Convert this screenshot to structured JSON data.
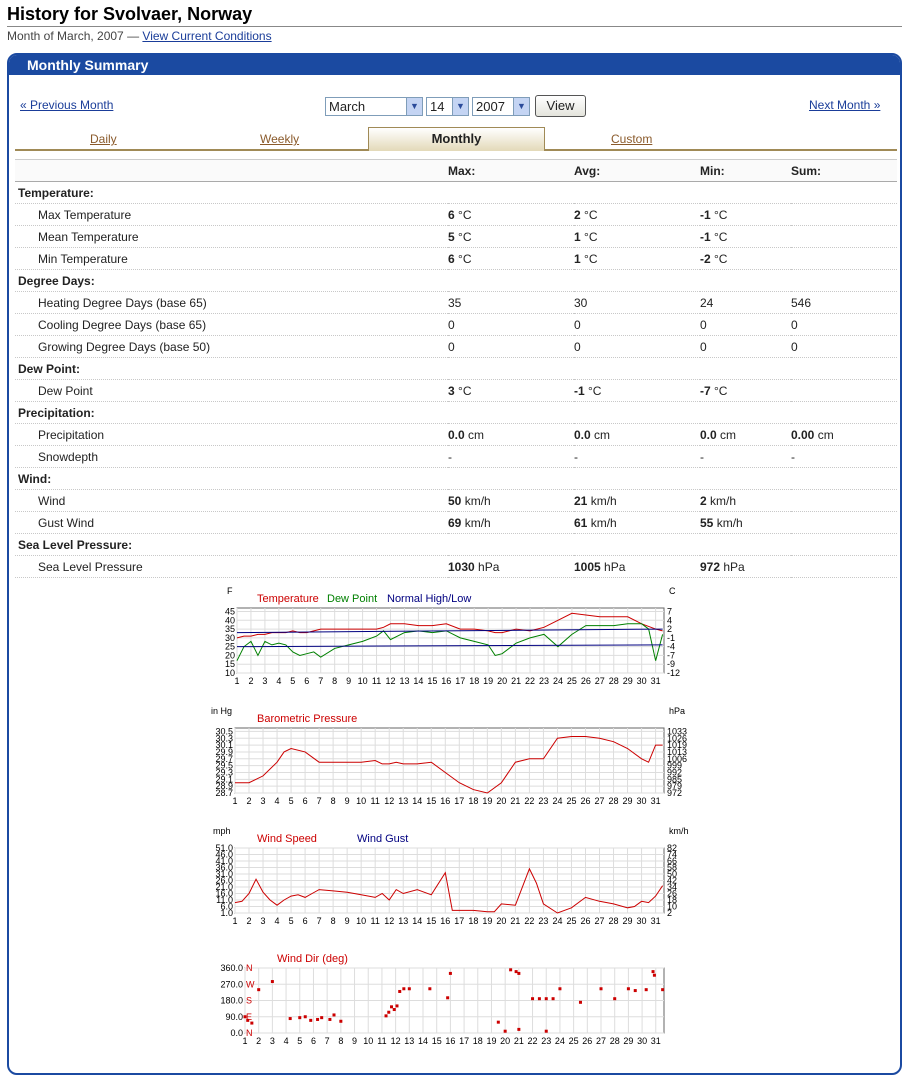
{
  "header": {
    "title": "History for Svolvaer, Norway",
    "subtitle_text": "Month of March, 2007 —",
    "current_link": "View Current Conditions"
  },
  "panel": {
    "title": "Monthly Summary",
    "prev_link": "« Previous Month",
    "next_link": "Next Month »",
    "month_value": "March",
    "day_value": "14",
    "year_value": "2007",
    "view_button": "View"
  },
  "tabs": {
    "daily": "Daily",
    "weekly": "Weekly",
    "monthly": "Monthly",
    "custom": "Custom"
  },
  "table": {
    "headers": [
      "Max:",
      "Avg:",
      "Min:",
      "Sum:"
    ],
    "sections": [
      {
        "title": "Temperature:",
        "rows": [
          {
            "label": "Max Temperature",
            "max": "6",
            "max_u": " °C",
            "avg": "2",
            "avg_u": " °C",
            "min": "-1",
            "min_u": " °C",
            "sum": ""
          },
          {
            "label": "Mean Temperature",
            "max": "5",
            "max_u": " °C",
            "avg": "1",
            "avg_u": " °C",
            "min": "-1",
            "min_u": " °C",
            "sum": ""
          },
          {
            "label": "Min Temperature",
            "max": "6",
            "max_u": " °C",
            "avg": "1",
            "avg_u": " °C",
            "min": "-2",
            "min_u": " °C",
            "sum": ""
          }
        ]
      },
      {
        "title": "Degree Days:",
        "rows": [
          {
            "label": "Heating Degree Days (base 65)",
            "max": "35",
            "avg": "30",
            "min": "24",
            "sum": "546",
            "plain": true
          },
          {
            "label": "Cooling Degree Days (base 65)",
            "max": "0",
            "avg": "0",
            "min": "0",
            "sum": "0",
            "plain": true
          },
          {
            "label": "Growing Degree Days (base 50)",
            "max": "0",
            "avg": "0",
            "min": "0",
            "sum": "0",
            "plain": true
          }
        ]
      },
      {
        "title": "Dew Point:",
        "rows": [
          {
            "label": "Dew Point",
            "max": "3",
            "max_u": " °C",
            "avg": "-1",
            "avg_u": " °C",
            "min": "-7",
            "min_u": " °C",
            "sum": ""
          }
        ]
      },
      {
        "title": "Precipitation:",
        "rows": [
          {
            "label": "Precipitation",
            "max": "0.0",
            "max_u": " cm",
            "avg": "0.0",
            "avg_u": " cm",
            "min": "0.0",
            "min_u": " cm",
            "sum": "0.00",
            "sum_u": " cm"
          },
          {
            "label": "Snowdepth",
            "max": "-",
            "avg": "-",
            "min": "-",
            "sum": "-",
            "plain": true
          }
        ]
      },
      {
        "title": "Wind:",
        "rows": [
          {
            "label": "Wind",
            "max": "50",
            "max_u": " km/h",
            "avg": "21",
            "avg_u": " km/h",
            "min": "2",
            "min_u": " km/h",
            "sum": ""
          },
          {
            "label": "Gust Wind",
            "max": "69",
            "max_u": " km/h",
            "avg": "61",
            "avg_u": " km/h",
            "min": "55",
            "min_u": " km/h",
            "sum": ""
          }
        ]
      },
      {
        "title": "Sea Level Pressure:",
        "rows": [
          {
            "label": "Sea Level Pressure",
            "max": "1030",
            "max_u": " hPa",
            "avg": "1005",
            "avg_u": " hPa",
            "min": "972",
            "min_u": " hPa",
            "sum": ""
          }
        ]
      }
    ]
  },
  "colors": {
    "brand": "#1b4aa1",
    "temp": "#cc0000",
    "dew": "#008000",
    "normal": "#000080"
  },
  "chart_data": [
    {
      "type": "line",
      "left_unit": "F",
      "right_unit": "C",
      "y_ticks_left": [
        45,
        40,
        35,
        30,
        25,
        20,
        15,
        10
      ],
      "y_ticks_right": [
        "7",
        "4",
        "2",
        "-1",
        "-4",
        "-7",
        "-9",
        "-12"
      ],
      "ylim": [
        10,
        47
      ],
      "x_ticks": [
        "1",
        "2",
        "3",
        "4",
        "5",
        "6",
        "7",
        "8",
        "9",
        "10",
        "11",
        "12",
        "13",
        "14",
        "15",
        "16",
        "17",
        "18",
        "19",
        "20",
        "21",
        "22",
        "23",
        "24",
        "25",
        "26",
        "27",
        "28",
        "29",
        "30",
        "31"
      ],
      "series": [
        {
          "name": "Temperature",
          "color": "#cc0000",
          "x": [
            1,
            1.5,
            2,
            2.5,
            3,
            3.5,
            4,
            4.5,
            5,
            5.5,
            6,
            6.5,
            7,
            8,
            9,
            10,
            11,
            11.5,
            12,
            13,
            14,
            15,
            16,
            17,
            18,
            19,
            19.5,
            20,
            21,
            22,
            23,
            24,
            25,
            26,
            27,
            28,
            29,
            30,
            31,
            31.5
          ],
          "y": [
            30,
            31,
            31,
            32,
            32,
            33,
            33,
            33,
            34,
            33,
            33,
            34,
            35,
            35,
            35,
            35,
            35,
            36,
            38,
            38,
            37,
            37,
            38,
            35,
            35,
            34,
            33,
            33,
            35,
            34,
            36,
            40,
            44,
            43,
            42,
            42,
            42,
            38,
            35,
            34
          ]
        },
        {
          "name": "Dew Point",
          "color": "#008000",
          "x": [
            1,
            1.5,
            2,
            2.5,
            3,
            3.5,
            4,
            4.5,
            5,
            5.5,
            6,
            6.5,
            7,
            8,
            9,
            10,
            11,
            11.5,
            12,
            13,
            14,
            15,
            16,
            17,
            18,
            19,
            19.5,
            20,
            21,
            22,
            23,
            24,
            25,
            26,
            27,
            28,
            29,
            30,
            30.5,
            31,
            31.5
          ],
          "y": [
            17,
            25,
            28,
            20,
            28,
            26,
            27,
            26,
            22,
            20,
            21,
            22,
            19,
            24,
            26,
            28,
            31,
            34,
            29,
            33,
            34,
            33,
            34,
            30,
            28,
            26,
            20,
            21,
            27,
            30,
            32,
            25,
            32,
            37,
            37,
            37,
            38,
            38,
            35,
            17,
            32
          ]
        },
        {
          "name": "Normal High/Low",
          "color": "#000080",
          "x": [
            1,
            31.5
          ],
          "y": [
            33,
            35
          ],
          "x2": [
            1,
            31.5
          ],
          "y2": [
            25,
            26
          ]
        }
      ]
    },
    {
      "type": "line",
      "left_unit": "in Hg",
      "right_unit": "hPa",
      "title": "Barometric Pressure",
      "y_ticks_left": [
        "30.5",
        "30.3",
        "30.1",
        "29.9",
        "29.7",
        "29.5",
        "29.3",
        "29.1",
        "28.9",
        "28.7"
      ],
      "y_ticks_right": [
        "1033",
        "1026",
        "1019",
        "1013",
        "1006",
        "999",
        "992",
        "985",
        "979",
        "972"
      ],
      "ylim": [
        28.7,
        30.6
      ],
      "x_ticks": [
        "1",
        "2",
        "3",
        "4",
        "5",
        "6",
        "7",
        "8",
        "9",
        "10",
        "11",
        "12",
        "13",
        "14",
        "15",
        "16",
        "17",
        "18",
        "19",
        "20",
        "21",
        "22",
        "23",
        "24",
        "25",
        "26",
        "27",
        "28",
        "29",
        "30",
        "31"
      ],
      "series": [
        {
          "name": "Barometric Pressure",
          "color": "#cc0000",
          "x": [
            1,
            2,
            3,
            4,
            4.5,
            5,
            6,
            7,
            8,
            9,
            10,
            11,
            11.5,
            12,
            12.5,
            13,
            14,
            15,
            16,
            17,
            18,
            19,
            20,
            21,
            22,
            23,
            24,
            25,
            26,
            27,
            28,
            29,
            30,
            30.5,
            31,
            31.5
          ],
          "y": [
            29.0,
            29.0,
            29.2,
            29.6,
            29.9,
            30.0,
            29.9,
            29.6,
            29.6,
            29.6,
            29.6,
            29.65,
            29.55,
            29.55,
            29.6,
            29.55,
            29.55,
            29.6,
            29.3,
            29.0,
            28.8,
            28.7,
            29.0,
            29.6,
            29.7,
            29.7,
            30.3,
            30.35,
            30.35,
            30.3,
            30.2,
            30.0,
            29.7,
            29.6,
            30.1,
            30.1
          ]
        }
      ]
    },
    {
      "type": "line",
      "left_unit": "mph",
      "right_unit": "km/h",
      "y_ticks_left": [
        "51.0",
        "46.0",
        "41.0",
        "36.0",
        "31.0",
        "26.0",
        "21.0",
        "16.0",
        "11.0",
        "6.0",
        "1.0"
      ],
      "y_ticks_right": [
        "82",
        "74",
        "66",
        "58",
        "50",
        "42",
        "34",
        "26",
        "18",
        "10",
        "2"
      ],
      "ylim": [
        1,
        51
      ],
      "x_ticks": [
        "1",
        "2",
        "3",
        "4",
        "5",
        "6",
        "7",
        "8",
        "9",
        "10",
        "11",
        "12",
        "13",
        "14",
        "15",
        "16",
        "17",
        "18",
        "19",
        "20",
        "21",
        "22",
        "23",
        "24",
        "25",
        "26",
        "27",
        "28",
        "29",
        "30",
        "31"
      ],
      "series": [
        {
          "name": "Wind Speed",
          "color": "#cc0000",
          "x": [
            1,
            1.5,
            2,
            2.5,
            3,
            3.5,
            4,
            4.5,
            5,
            5.5,
            6,
            6.5,
            7,
            8,
            9,
            10,
            11,
            11.5,
            12,
            12.5,
            13,
            14,
            15,
            16,
            16.5,
            17,
            18,
            19,
            19.5,
            20,
            21,
            22,
            22.5,
            23,
            24,
            25,
            26,
            27,
            28,
            29,
            29.5,
            30,
            30.5,
            31,
            31.5
          ],
          "y": [
            9,
            10,
            16,
            27,
            17,
            11,
            7,
            11,
            14,
            15,
            13,
            16,
            19,
            18,
            17,
            15,
            13,
            16,
            11,
            19,
            16,
            19,
            15,
            32,
            3,
            3,
            3,
            2,
            2,
            8,
            7,
            35,
            24,
            8,
            1,
            5,
            13,
            10,
            8,
            5,
            6,
            10,
            9,
            14,
            22
          ]
        },
        {
          "name": "Wind Gust",
          "color": "#000080",
          "x": [],
          "y": []
        }
      ]
    },
    {
      "type": "scatter",
      "title": "Wind Dir (deg)",
      "y_ticks_left": [
        "360.0",
        "270.0",
        "180.0",
        "90.0",
        "0.0"
      ],
      "y_ticks_dir": [
        "N",
        "W",
        "S",
        "E",
        "N"
      ],
      "ylim": [
        0,
        360
      ],
      "x_ticks": [
        "1",
        "2",
        "3",
        "4",
        "5",
        "6",
        "7",
        "8",
        "9",
        "10",
        "11",
        "12",
        "13",
        "14",
        "15",
        "16",
        "17",
        "18",
        "19",
        "20",
        "21",
        "22",
        "23",
        "24",
        "25",
        "26",
        "27",
        "28",
        "29",
        "30",
        "31"
      ],
      "series": [
        {
          "name": "Wind Dir (deg)",
          "color": "#cc0000",
          "x": [
            1,
            1.2,
            1.5,
            2,
            3,
            4.3,
            5,
            5.4,
            5.8,
            6.3,
            6.6,
            7.2,
            7.5,
            8,
            11.3,
            11.5,
            11.7,
            11.9,
            12.1,
            12.3,
            12.6,
            13,
            14.5,
            15.8,
            16,
            19.5,
            20,
            20.4,
            20.8,
            21,
            21,
            22,
            22.5,
            23,
            23,
            23.5,
            24,
            25.5,
            27,
            28,
            29,
            29.5,
            30.3,
            30.8,
            30.9,
            31.5
          ],
          "y": [
            90,
            70,
            55,
            240,
            285,
            80,
            85,
            90,
            70,
            75,
            85,
            75,
            100,
            65,
            95,
            115,
            145,
            130,
            150,
            230,
            245,
            245,
            245,
            195,
            330,
            60,
            10,
            350,
            340,
            330,
            20,
            190,
            190,
            190,
            10,
            190,
            245,
            170,
            245,
            190,
            245,
            235,
            240,
            340,
            320,
            240
          ]
        }
      ]
    }
  ]
}
